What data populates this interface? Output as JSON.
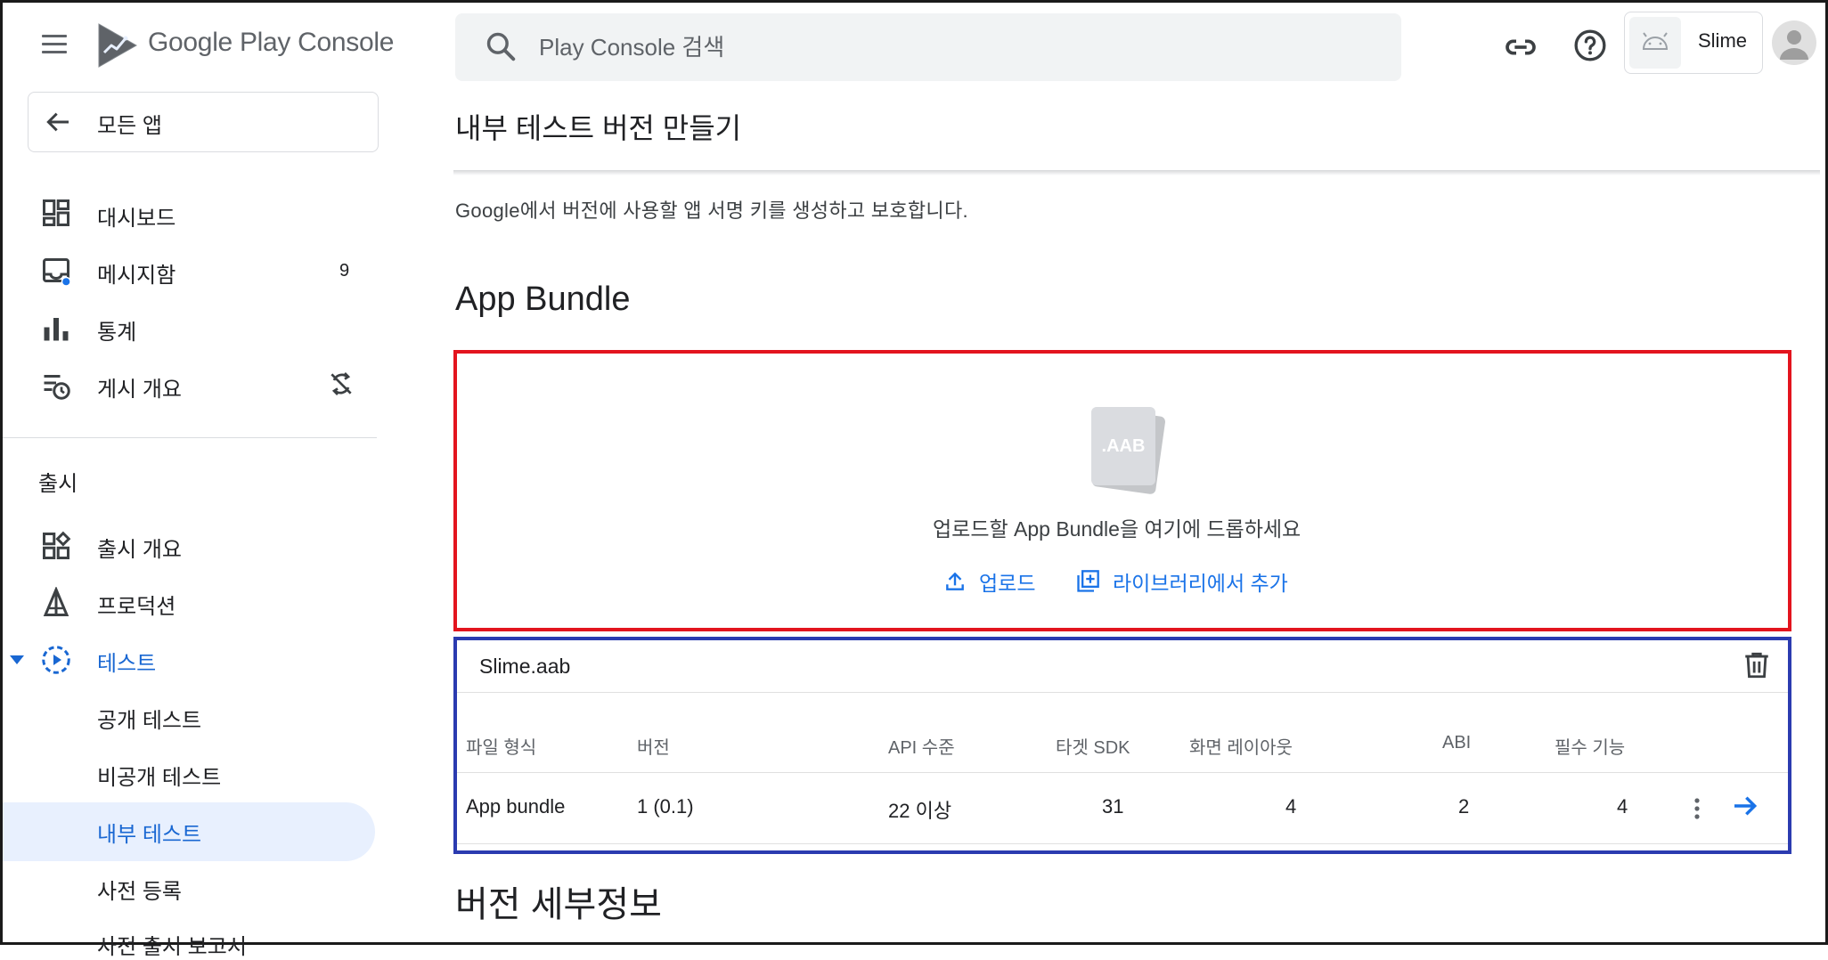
{
  "header": {
    "brand": "Google Play Console",
    "search_placeholder": "Play Console 검색",
    "app_name": "Slime"
  },
  "sidebar": {
    "back_label": "모든 앱",
    "items": [
      {
        "label": "대시보드",
        "icon": "dashboard-icon"
      },
      {
        "label": "메시지함",
        "icon": "inbox-icon",
        "count": "9"
      },
      {
        "label": "통계",
        "icon": "bar-chart-icon"
      },
      {
        "label": "게시 개요",
        "icon": "publishing-overview-icon"
      }
    ],
    "section_heading": "출시",
    "release_items": [
      {
        "label": "출시 개요",
        "icon": "release-overview-icon"
      },
      {
        "label": "프로덕션",
        "icon": "production-icon"
      },
      {
        "label": "테스트",
        "icon": "testing-icon"
      }
    ],
    "testing_sub": [
      "공개 테스트",
      "비공개 테스트",
      "내부 테스트",
      "사전 등록"
    ],
    "cut_item": "사전 출시 보고서",
    "active_color": "#1967d2"
  },
  "main": {
    "page_title": "내부 테스트 버전 만들기",
    "signing_note": "Google에서 버전에 사용할 앱 서명 키를 생성하고 보호합니다.",
    "bundle_heading": "App Bundle",
    "dropzone": {
      "file_badge": ".AAB",
      "prompt": "업로드할 App Bundle을 여기에 드롭하세요",
      "upload_label": "업로드",
      "library_label": "라이브러리에서 추가",
      "border_color": "#e3141e"
    },
    "file_card": {
      "file_name": "Slime.aab",
      "border_color": "#2b3bb0",
      "columns": [
        "파일 형식",
        "버전",
        "API 수준",
        "타겟 SDK",
        "화면 레이아웃",
        "ABI",
        "필수 기능"
      ],
      "row": [
        "App bundle",
        "1 (0.1)",
        "22 이상",
        "31",
        "4",
        "2",
        "4"
      ]
    },
    "details_heading": "버전 세부정보"
  }
}
